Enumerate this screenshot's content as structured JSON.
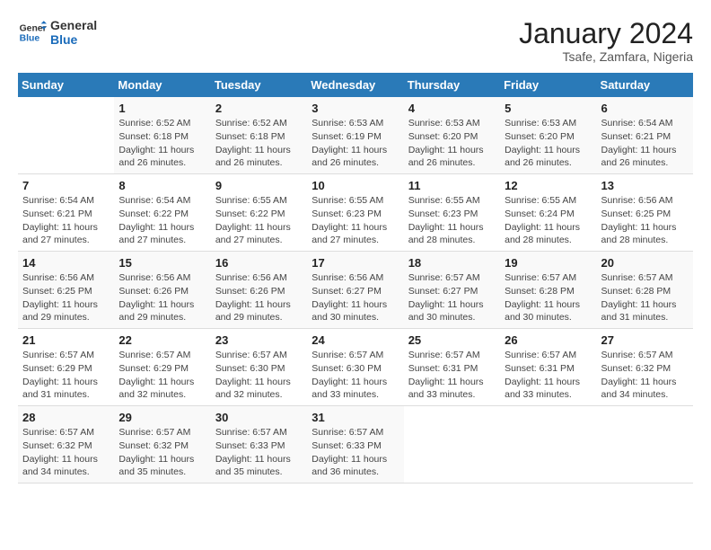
{
  "header": {
    "logo_general": "General",
    "logo_blue": "Blue",
    "title": "January 2024",
    "subtitle": "Tsafe, Zamfara, Nigeria"
  },
  "days_of_week": [
    "Sunday",
    "Monday",
    "Tuesday",
    "Wednesday",
    "Thursday",
    "Friday",
    "Saturday"
  ],
  "weeks": [
    [
      {
        "num": "",
        "info": ""
      },
      {
        "num": "1",
        "info": "Sunrise: 6:52 AM\nSunset: 6:18 PM\nDaylight: 11 hours\nand 26 minutes."
      },
      {
        "num": "2",
        "info": "Sunrise: 6:52 AM\nSunset: 6:18 PM\nDaylight: 11 hours\nand 26 minutes."
      },
      {
        "num": "3",
        "info": "Sunrise: 6:53 AM\nSunset: 6:19 PM\nDaylight: 11 hours\nand 26 minutes."
      },
      {
        "num": "4",
        "info": "Sunrise: 6:53 AM\nSunset: 6:20 PM\nDaylight: 11 hours\nand 26 minutes."
      },
      {
        "num": "5",
        "info": "Sunrise: 6:53 AM\nSunset: 6:20 PM\nDaylight: 11 hours\nand 26 minutes."
      },
      {
        "num": "6",
        "info": "Sunrise: 6:54 AM\nSunset: 6:21 PM\nDaylight: 11 hours\nand 26 minutes."
      }
    ],
    [
      {
        "num": "7",
        "info": "Sunrise: 6:54 AM\nSunset: 6:21 PM\nDaylight: 11 hours\nand 27 minutes."
      },
      {
        "num": "8",
        "info": "Sunrise: 6:54 AM\nSunset: 6:22 PM\nDaylight: 11 hours\nand 27 minutes."
      },
      {
        "num": "9",
        "info": "Sunrise: 6:55 AM\nSunset: 6:22 PM\nDaylight: 11 hours\nand 27 minutes."
      },
      {
        "num": "10",
        "info": "Sunrise: 6:55 AM\nSunset: 6:23 PM\nDaylight: 11 hours\nand 27 minutes."
      },
      {
        "num": "11",
        "info": "Sunrise: 6:55 AM\nSunset: 6:23 PM\nDaylight: 11 hours\nand 28 minutes."
      },
      {
        "num": "12",
        "info": "Sunrise: 6:55 AM\nSunset: 6:24 PM\nDaylight: 11 hours\nand 28 minutes."
      },
      {
        "num": "13",
        "info": "Sunrise: 6:56 AM\nSunset: 6:25 PM\nDaylight: 11 hours\nand 28 minutes."
      }
    ],
    [
      {
        "num": "14",
        "info": "Sunrise: 6:56 AM\nSunset: 6:25 PM\nDaylight: 11 hours\nand 29 minutes."
      },
      {
        "num": "15",
        "info": "Sunrise: 6:56 AM\nSunset: 6:26 PM\nDaylight: 11 hours\nand 29 minutes."
      },
      {
        "num": "16",
        "info": "Sunrise: 6:56 AM\nSunset: 6:26 PM\nDaylight: 11 hours\nand 29 minutes."
      },
      {
        "num": "17",
        "info": "Sunrise: 6:56 AM\nSunset: 6:27 PM\nDaylight: 11 hours\nand 30 minutes."
      },
      {
        "num": "18",
        "info": "Sunrise: 6:57 AM\nSunset: 6:27 PM\nDaylight: 11 hours\nand 30 minutes."
      },
      {
        "num": "19",
        "info": "Sunrise: 6:57 AM\nSunset: 6:28 PM\nDaylight: 11 hours\nand 30 minutes."
      },
      {
        "num": "20",
        "info": "Sunrise: 6:57 AM\nSunset: 6:28 PM\nDaylight: 11 hours\nand 31 minutes."
      }
    ],
    [
      {
        "num": "21",
        "info": "Sunrise: 6:57 AM\nSunset: 6:29 PM\nDaylight: 11 hours\nand 31 minutes."
      },
      {
        "num": "22",
        "info": "Sunrise: 6:57 AM\nSunset: 6:29 PM\nDaylight: 11 hours\nand 32 minutes."
      },
      {
        "num": "23",
        "info": "Sunrise: 6:57 AM\nSunset: 6:30 PM\nDaylight: 11 hours\nand 32 minutes."
      },
      {
        "num": "24",
        "info": "Sunrise: 6:57 AM\nSunset: 6:30 PM\nDaylight: 11 hours\nand 33 minutes."
      },
      {
        "num": "25",
        "info": "Sunrise: 6:57 AM\nSunset: 6:31 PM\nDaylight: 11 hours\nand 33 minutes."
      },
      {
        "num": "26",
        "info": "Sunrise: 6:57 AM\nSunset: 6:31 PM\nDaylight: 11 hours\nand 33 minutes."
      },
      {
        "num": "27",
        "info": "Sunrise: 6:57 AM\nSunset: 6:32 PM\nDaylight: 11 hours\nand 34 minutes."
      }
    ],
    [
      {
        "num": "28",
        "info": "Sunrise: 6:57 AM\nSunset: 6:32 PM\nDaylight: 11 hours\nand 34 minutes."
      },
      {
        "num": "29",
        "info": "Sunrise: 6:57 AM\nSunset: 6:32 PM\nDaylight: 11 hours\nand 35 minutes."
      },
      {
        "num": "30",
        "info": "Sunrise: 6:57 AM\nSunset: 6:33 PM\nDaylight: 11 hours\nand 35 minutes."
      },
      {
        "num": "31",
        "info": "Sunrise: 6:57 AM\nSunset: 6:33 PM\nDaylight: 11 hours\nand 36 minutes."
      },
      {
        "num": "",
        "info": ""
      },
      {
        "num": "",
        "info": ""
      },
      {
        "num": "",
        "info": ""
      }
    ]
  ]
}
